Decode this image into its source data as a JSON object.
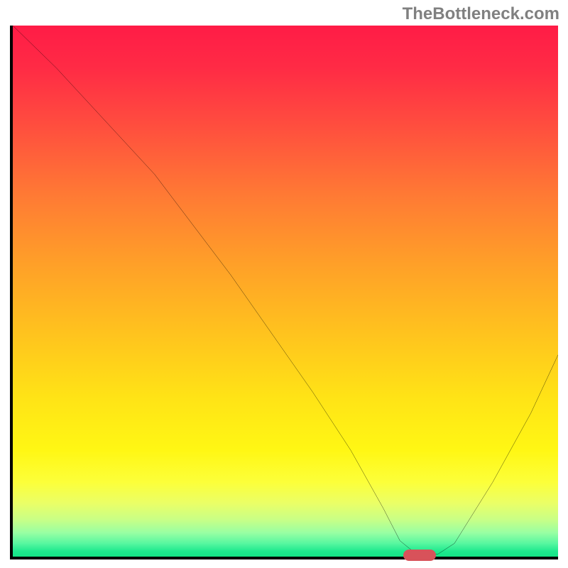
{
  "watermark": "TheBottleneck.com",
  "chart_data": {
    "type": "line",
    "title": "",
    "xlabel": "",
    "ylabel": "",
    "xlim": [
      0,
      100
    ],
    "ylim": [
      0,
      100
    ],
    "series": [
      {
        "name": "bottleneck-curve",
        "x": [
          0,
          8,
          26,
          40,
          55,
          62,
          68,
          71,
          74,
          78,
          81,
          88,
          95,
          100
        ],
        "y": [
          100,
          92,
          72,
          53,
          31,
          20,
          9,
          3,
          0.5,
          0.5,
          2.5,
          14,
          27,
          38
        ]
      }
    ],
    "marker": {
      "x_start": 72,
      "x_end": 78,
      "y": 0
    },
    "colors": {
      "gradient_top": "#ff1c46",
      "gradient_mid": "#ffe316",
      "gradient_bottom": "#14e486",
      "curve": "#000000",
      "marker": "#d8525a",
      "axis": "#000000"
    }
  }
}
